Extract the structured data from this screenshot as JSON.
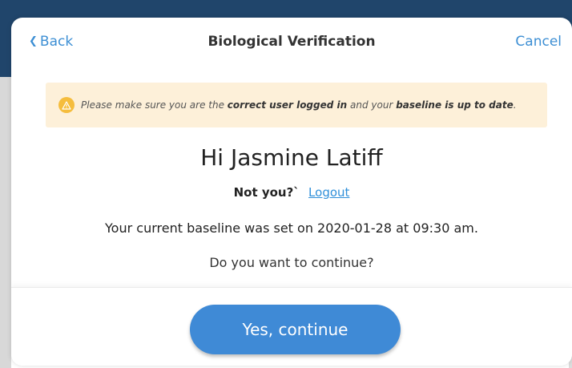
{
  "navbar": {
    "back_label": "Back",
    "title": "Biological Verification",
    "cancel_label": "Cancel"
  },
  "warning": {
    "icon": "warning-triangle-icon",
    "text_1": "Please make sure you are the ",
    "bold_1": "correct user logged in",
    "text_2": " and your ",
    "bold_2": "baseline is up to date",
    "text_3": "."
  },
  "greeting": "Hi Jasmine Latiff",
  "not_you": {
    "text": "Not you?`",
    "logout_label": "Logout"
  },
  "baseline_text": "Your current baseline was set on 2020-01-28 at 09:30 am.",
  "continue_question": "Do you want to continue?",
  "continue_button_label": "Yes, continue",
  "colors": {
    "accent": "#3f8ad6",
    "link": "#3d8fd4",
    "warning_bg": "#fdf0d9",
    "warning_icon": "#f5bd3d",
    "backdrop": "#20456b"
  }
}
